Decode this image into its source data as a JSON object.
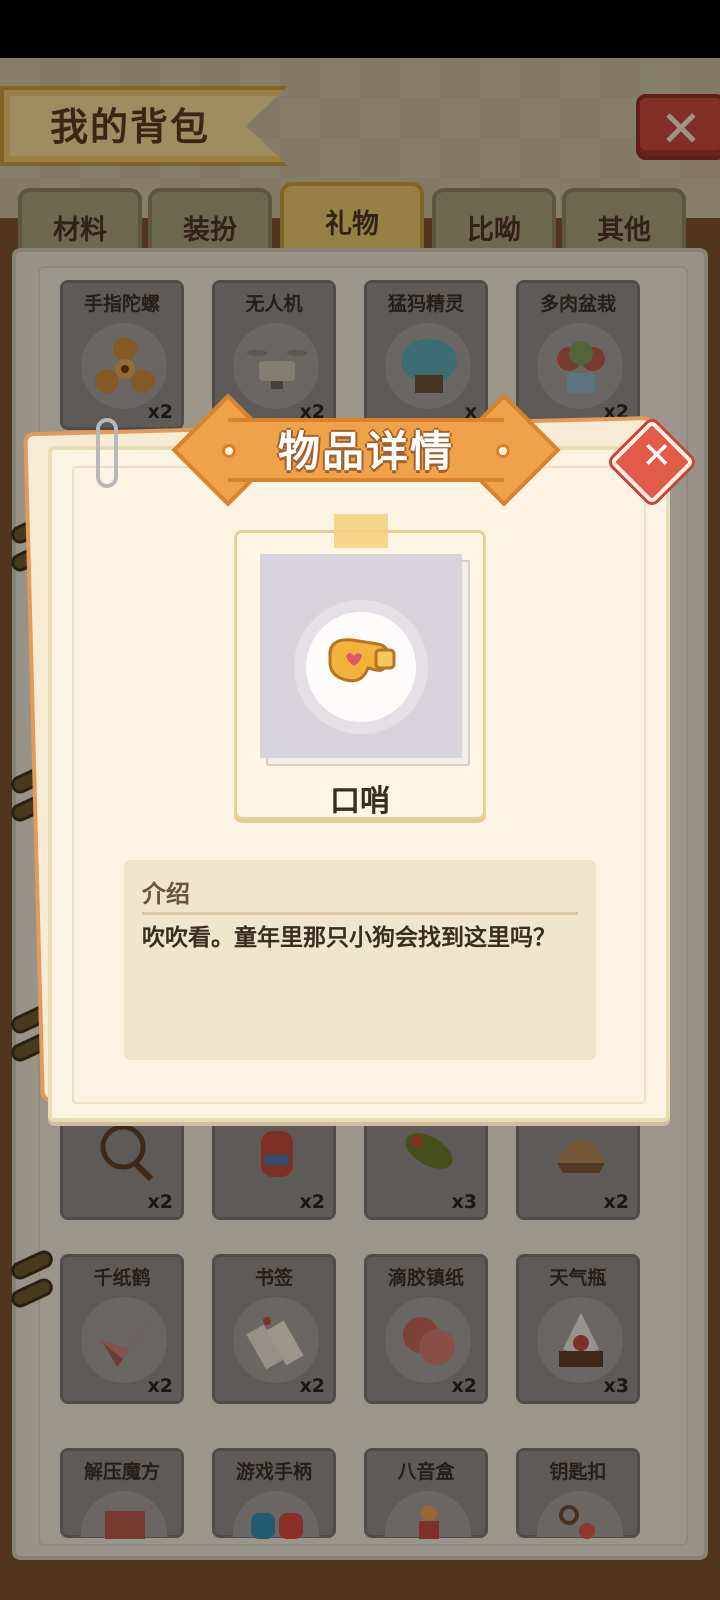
{
  "header": {
    "title": "我的背包"
  },
  "tabs": [
    {
      "label": "材料",
      "active": false
    },
    {
      "label": "装扮",
      "active": false
    },
    {
      "label": "礼物",
      "active": true
    },
    {
      "label": "比呦",
      "active": false
    },
    {
      "label": "其他",
      "active": false
    }
  ],
  "grid": {
    "row1": [
      {
        "name": "手指陀螺",
        "count": "x2",
        "icon": "fidget-spinner-icon"
      },
      {
        "name": "无人机",
        "count": "x2",
        "icon": "drone-icon"
      },
      {
        "name": "猛犸精灵",
        "count": "x",
        "icon": "mammoth-icon"
      },
      {
        "name": "多肉盆栽",
        "count": "x2",
        "icon": "succulent-icon"
      }
    ],
    "row4": [
      {
        "name": "",
        "count": "x2",
        "icon": "racket-icon"
      },
      {
        "name": "",
        "count": "x2",
        "icon": "bottle-icon"
      },
      {
        "name": "",
        "count": "x3",
        "icon": "leaf-icon"
      },
      {
        "name": "",
        "count": "x2",
        "icon": "shell-icon"
      }
    ],
    "row5": [
      {
        "name": "千纸鹤",
        "count": "x2",
        "icon": "paper-crane-icon"
      },
      {
        "name": "书签",
        "count": "x2",
        "icon": "bookmark-icon"
      },
      {
        "name": "滴胶镇纸",
        "count": "x2",
        "icon": "paperweight-icon"
      },
      {
        "name": "天气瓶",
        "count": "x3",
        "icon": "weather-bottle-icon"
      }
    ],
    "row6": [
      {
        "name": "解压魔方",
        "count": "",
        "icon": "cube-icon"
      },
      {
        "name": "游戏手柄",
        "count": "",
        "icon": "gamepad-icon"
      },
      {
        "name": "八音盒",
        "count": "",
        "icon": "music-box-icon"
      },
      {
        "name": "钥匙扣",
        "count": "",
        "icon": "keychain-icon"
      }
    ]
  },
  "dialog": {
    "title": "物品详情",
    "item_name": "口哨",
    "item_icon": "whistle-icon",
    "desc_title": "介绍",
    "desc_text": "吹吹看。童年里那只小狗会找到这里吗？"
  },
  "colors": {
    "accent_orange": "#f0a24a",
    "close_red": "#e25a48",
    "tab_active": "#e6c66b"
  }
}
